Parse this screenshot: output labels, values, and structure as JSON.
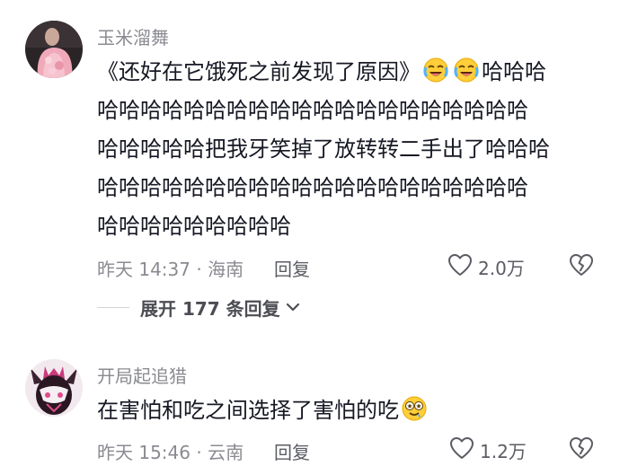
{
  "comments": [
    {
      "username": "玉米溜舞",
      "avatar_icon": "avatar-pink-coat-photo",
      "content_lines": [
        {
          "before_emoji": "《还好在它饿死之前发现了原因》",
          "after_emoji": "哈哈哈"
        },
        {
          "text": "哈哈哈哈哈哈哈哈哈哈哈哈哈哈哈哈哈哈哈哈"
        },
        {
          "text": "哈哈哈哈哈把我牙笑掉了放转转二手出了哈哈哈"
        },
        {
          "text": "哈哈哈哈哈哈哈哈哈哈哈哈哈哈哈哈哈哈哈哈"
        },
        {
          "text": "哈哈哈哈哈哈哈哈哈"
        }
      ],
      "emojis": [
        "crying-laughing-emoji",
        "crying-laughing-emoji"
      ],
      "meta": "昨天 14:37 · 海南",
      "reply_label": "回复",
      "like_count": "2.0万",
      "expand_replies_label": "展开 177 条回复"
    },
    {
      "username": "开局起追猎",
      "avatar_icon": "avatar-dark-anime-character",
      "content_lines": [
        {
          "text": "在害怕和吃之间选择了害怕的吃"
        }
      ],
      "emojis": [
        "drooling-star-eyes-emoji"
      ],
      "meta": "昨天 15:46 · 云南",
      "reply_label": "回复",
      "like_count": "1.2万"
    }
  ],
  "colors": {
    "primary_text": "#161823",
    "secondary_text": "#8a8b91",
    "action_text": "#5b5c63",
    "divider": "#d5d5d8"
  }
}
